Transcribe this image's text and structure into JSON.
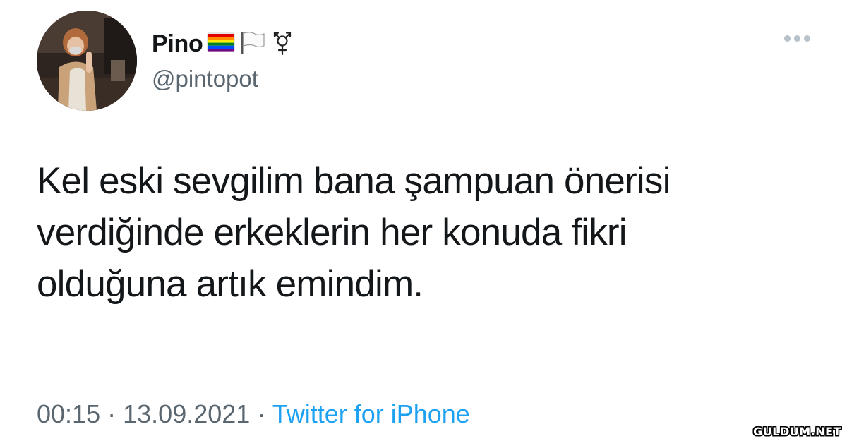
{
  "user": {
    "display_name": "Pino",
    "name_emojis": [
      "rainbow-flag-icon",
      "white-flag-icon",
      "transgender-symbol-icon"
    ],
    "handle": "@pintopot"
  },
  "tweet": {
    "lines": [
      "Kel eski sevgilim bana şampuan önerisi",
      "verdiğinde erkeklerin her konuda fikri",
      "olduğuna artık emindim."
    ]
  },
  "meta": {
    "time": "00:15",
    "separator": "·",
    "date": "13.09.2021",
    "source": "Twitter for iPhone"
  },
  "watermark": "GULDUM.NET",
  "colors": {
    "text": "#14171a",
    "secondary": "#5b6770",
    "link": "#1da1f2",
    "more_dots": "#b8c2ca"
  }
}
